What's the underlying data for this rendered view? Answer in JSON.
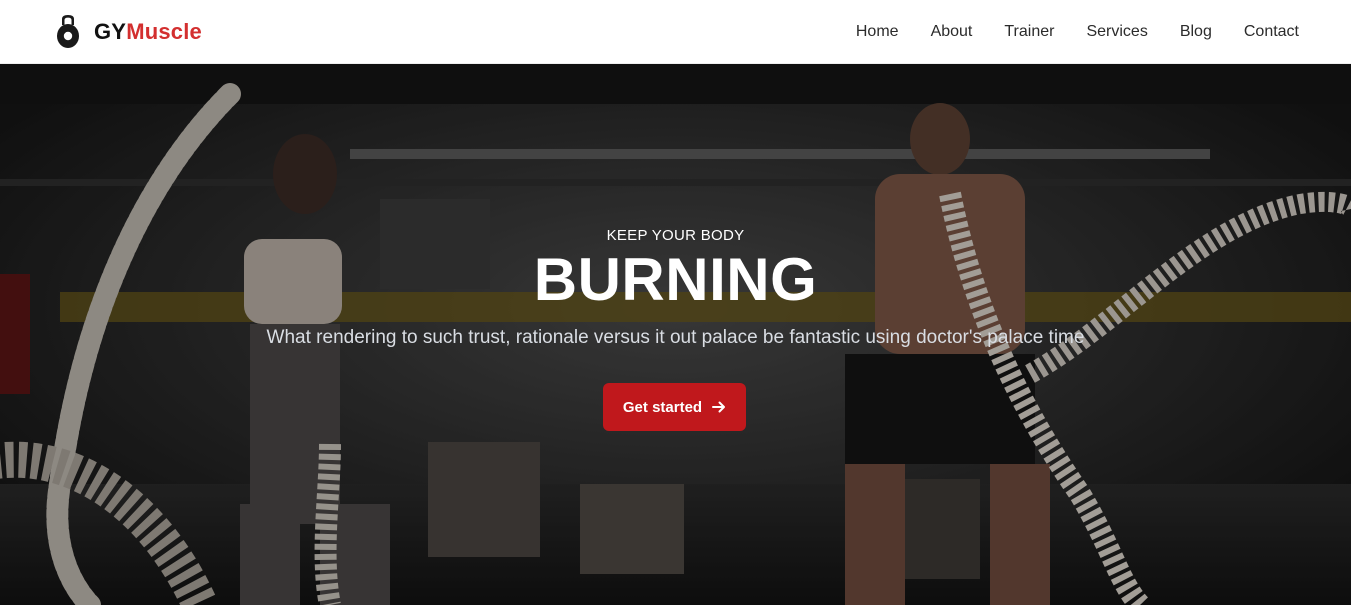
{
  "brand": {
    "name_part1": "GY",
    "name_part2": "Muscle",
    "icon": "kettlebell-icon",
    "accent_color": "#d32f2f"
  },
  "nav": {
    "items": [
      "Home",
      "About",
      "Trainer",
      "Services",
      "Blog",
      "Contact"
    ]
  },
  "hero": {
    "kicker": "KEEP YOUR BODY",
    "headline": "BURNING",
    "subtext": "What rendering to such trust, rationale versus it out palace be fantastic using doctor's palace time",
    "cta_label": "Get started",
    "cta_icon": "arrow-right-icon",
    "cta_color": "#c0181c",
    "background_image": "gym-battle-ropes-photo"
  }
}
